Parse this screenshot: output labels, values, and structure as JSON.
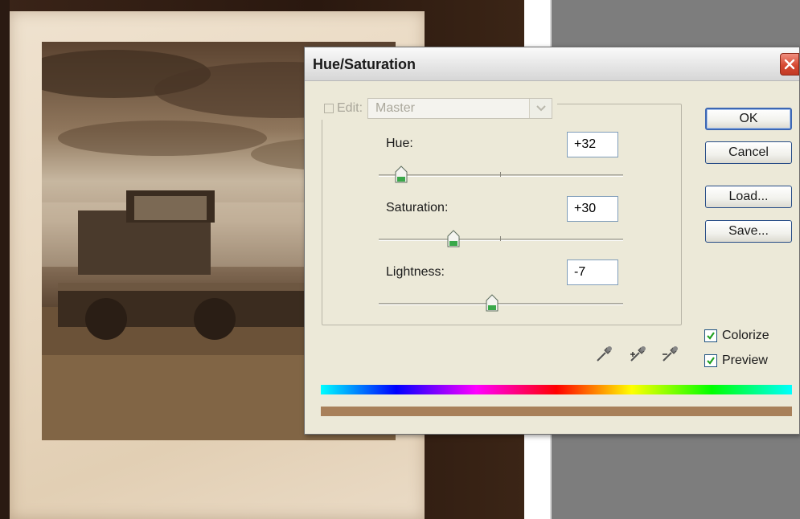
{
  "dialog": {
    "title": "Hue/Saturation",
    "edit_label": "Edit:",
    "edit_value": "Master"
  },
  "sliders": [
    {
      "label": "Hue:",
      "value": "+32",
      "position": 0.092
    },
    {
      "label": "Saturation:",
      "value": "+30",
      "position": 0.305
    },
    {
      "label": "Lightness:",
      "value": "-7",
      "position": 0.465
    }
  ],
  "buttons": {
    "ok": "OK",
    "cancel": "Cancel",
    "load": "Load...",
    "save": "Save..."
  },
  "options": {
    "colorize_label": "Colorize",
    "colorize_checked": true,
    "preview_label": "Preview",
    "preview_checked": true
  },
  "icons": [
    "close-icon",
    "dropdown-arrow-icon",
    "eyedropper-icon",
    "eyedropper-plus-icon",
    "eyedropper-minus-icon",
    "checkmark-icon"
  ],
  "colors": {
    "colorized_bar": "#a8805a",
    "thumb_green": "#3aa84a"
  }
}
